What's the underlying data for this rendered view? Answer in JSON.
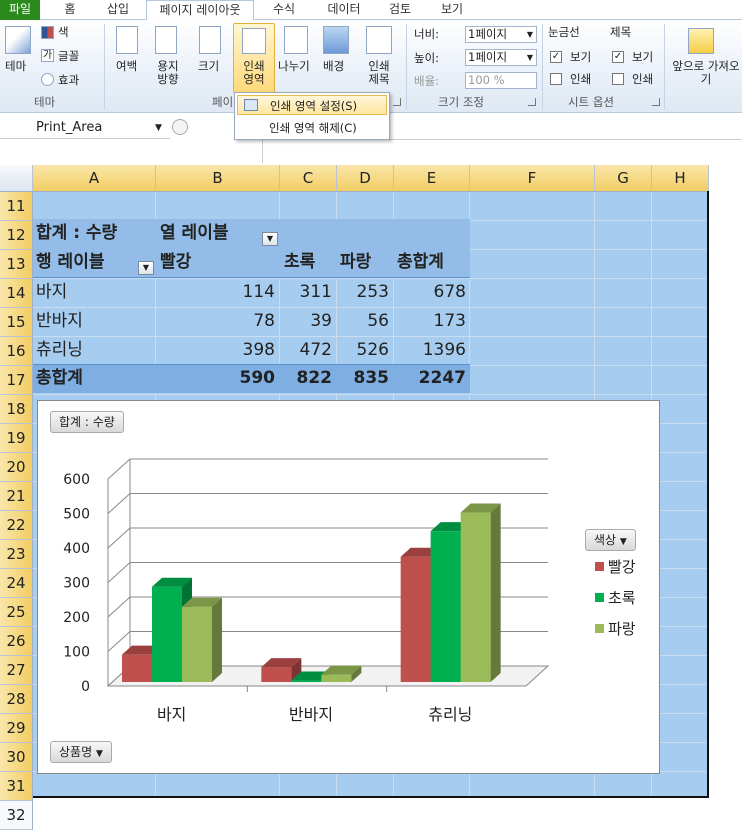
{
  "tabs": [
    "파일",
    "홈",
    "삽입",
    "페이지 레이아웃",
    "수식",
    "데이터",
    "검토",
    "보기"
  ],
  "ribbon": {
    "theme": {
      "theme_label": "테마",
      "colors": "색",
      "fonts": "글꼴",
      "effects": "효과",
      "group": "테마"
    },
    "page_setup": {
      "margins": "여백",
      "orientation": "용지 방향",
      "size": "크기",
      "print_area": "인쇄 영역",
      "breaks": "나누기",
      "background": "배경",
      "print_titles": "인쇄 제목",
      "group": "페이지 설정"
    },
    "scale": {
      "width_label": "너비:",
      "width_value": "1페이지",
      "height_label": "높이:",
      "height_value": "1페이지",
      "scale_label": "배율:",
      "scale_value": "100 %",
      "group": "크기 조정"
    },
    "sheet_options": {
      "gridlines": "눈금선",
      "headings": "제목",
      "view": "보기",
      "print": "인쇄",
      "group": "시트 옵션"
    },
    "arrange": {
      "bring_forward": "앞으로 가져오기"
    }
  },
  "dropdown_menu": [
    {
      "label": "인쇄 영역 설정(S)"
    },
    {
      "label": "인쇄 영역 해제(C)"
    }
  ],
  "name_box": "Print_Area",
  "columns": [
    "A",
    "B",
    "C",
    "D",
    "E",
    "F",
    "G",
    "H"
  ],
  "rows": [
    "11",
    "12",
    "13",
    "14",
    "15",
    "16",
    "17",
    "18",
    "19",
    "20",
    "21",
    "22",
    "23",
    "24",
    "25",
    "26",
    "27",
    "28",
    "29",
    "30",
    "31",
    "32"
  ],
  "pivot": {
    "values_label": "합계 : 수량",
    "col_labels": "열 레이블",
    "row_labels": "행 레이블",
    "headers": [
      "빨강",
      "초록",
      "파랑",
      "총합계"
    ],
    "rows": [
      {
        "name": "바지",
        "values": [
          "114",
          "311",
          "253",
          "678"
        ]
      },
      {
        "name": "반바지",
        "values": [
          "78",
          "39",
          "56",
          "173"
        ]
      },
      {
        "name": "츄리닝",
        "values": [
          "398",
          "472",
          "526",
          "1396"
        ]
      }
    ],
    "total": {
      "name": "총합계",
      "values": [
        "590",
        "822",
        "835",
        "2247"
      ]
    }
  },
  "chart": {
    "values_button": "합계 : 수량",
    "axis_button": "상품명",
    "legend_button": "색상"
  },
  "chart_data": {
    "type": "bar",
    "categories": [
      "바지",
      "반바지",
      "츄리닝"
    ],
    "series": [
      {
        "name": "빨강",
        "values": [
          114,
          78,
          398
        ],
        "color": "#c0504d"
      },
      {
        "name": "초록",
        "values": [
          311,
          39,
          472
        ],
        "color": "#00b050"
      },
      {
        "name": "파랑",
        "values": [
          253,
          56,
          526
        ],
        "color": "#9bbb59"
      }
    ],
    "y_ticks": [
      0,
      100,
      200,
      300,
      400,
      500,
      600
    ],
    "ylim": [
      0,
      600
    ],
    "grid": true,
    "legend_position": "right"
  },
  "colors": {
    "print_area": "#a6cdef",
    "pivot_band": "#93bde8",
    "file_tab": "#2b8a1e",
    "selected_header": "#f2cd62"
  }
}
